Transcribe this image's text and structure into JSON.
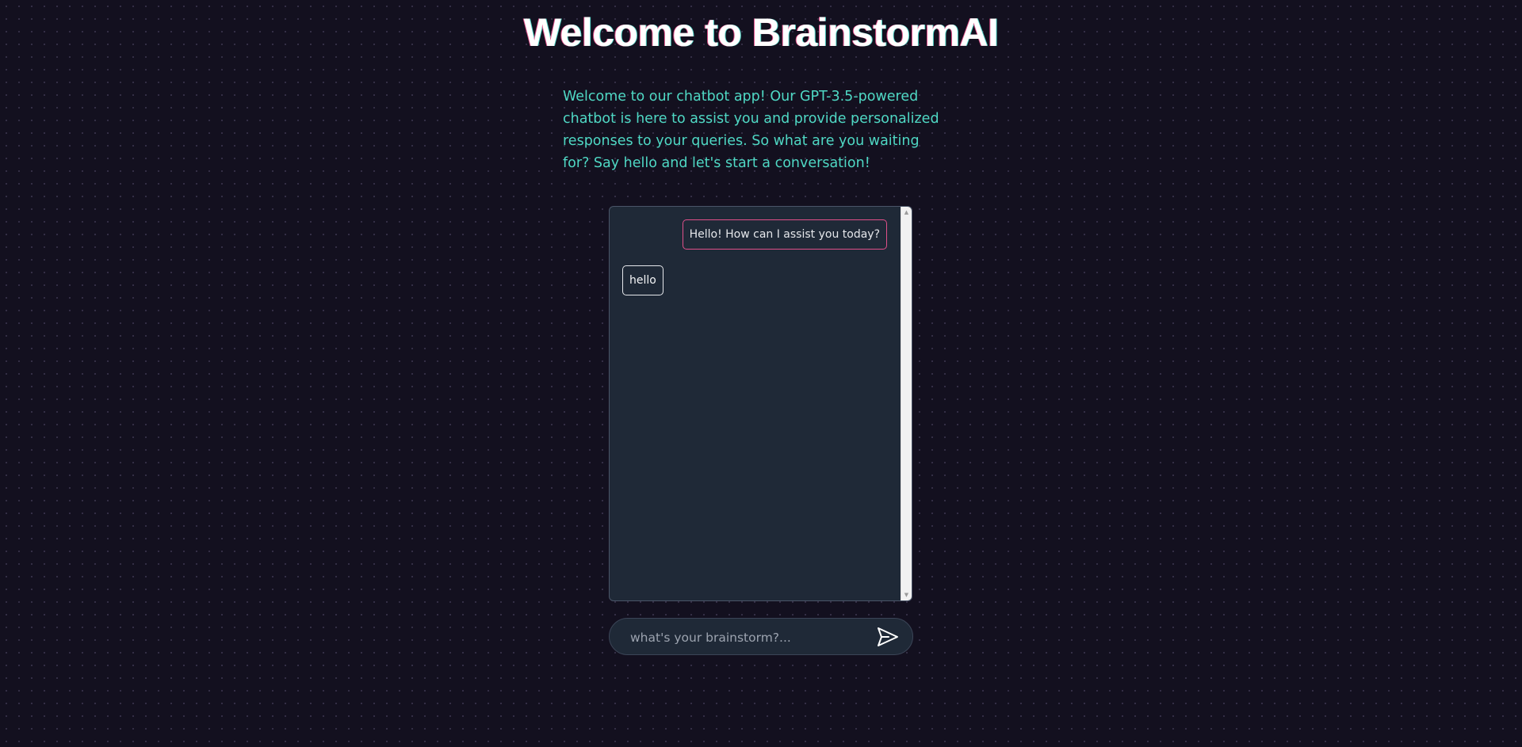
{
  "header": {
    "title": "Welcome to BrainstormAI",
    "intro": "Welcome to our chatbot app! Our GPT-3.5-powered chatbot is here to assist you and provide personalized responses to your queries. So what are you waiting for? Say hello and let's start a conversation!"
  },
  "chat": {
    "messages": [
      {
        "role": "bot",
        "text": "Hello! How can I assist you today?"
      },
      {
        "role": "user",
        "text": "hello"
      }
    ]
  },
  "composer": {
    "placeholder": "what's your brainstorm?...",
    "value": "",
    "send_icon": "send-icon"
  },
  "colors": {
    "background": "#13101f",
    "accent_teal": "#4fd8c4",
    "accent_pink": "#e0508a",
    "panel": "#1f2937"
  }
}
